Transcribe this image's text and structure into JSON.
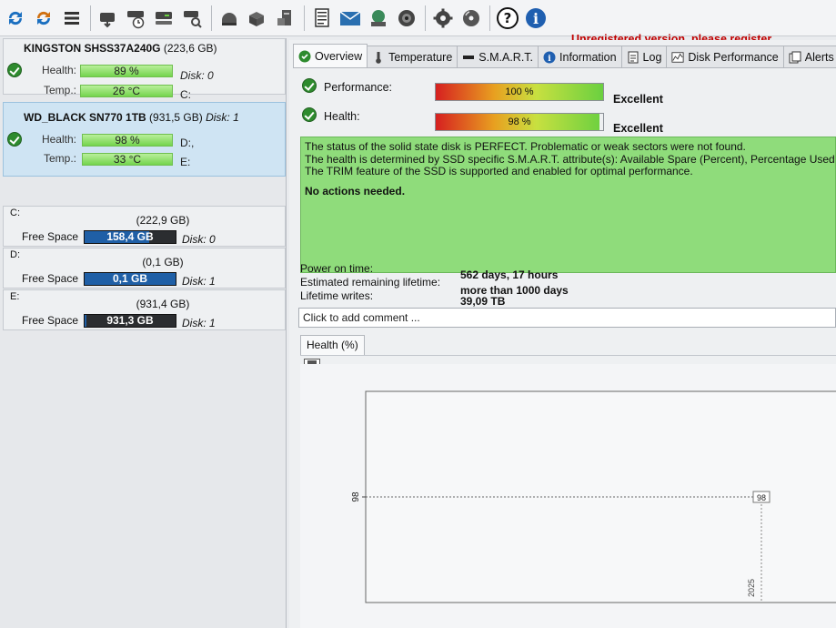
{
  "register_text": "Unregistered version, please register.",
  "disks": [
    {
      "model": "KINGSTON SHSS37A240G",
      "size": "(223,6 GB)",
      "disk_label": "",
      "health_label": "Health:",
      "health_value": "89 %",
      "temp_label": "Temp.:",
      "temp_value": "26 °C",
      "disk_index": "Disk: 0",
      "volume": "C:"
    },
    {
      "model": "WD_BLACK SN770 1TB",
      "size": "(931,5 GB)",
      "disk_label": "Disk: 1",
      "health_label": "Health:",
      "health_value": "98 %",
      "temp_label": "Temp.:",
      "temp_value": "33 °C",
      "disk_index": "D:,",
      "volume": "E:"
    }
  ],
  "volumes": [
    {
      "letter": "C:",
      "total": "(222,9 GB)",
      "free_label": "Free Space",
      "free": "158,4 GB",
      "free_fraction": 0.71,
      "disk": "Disk: 0"
    },
    {
      "letter": "D:",
      "total": "(0,1 GB)",
      "free_label": "Free Space",
      "free": "0,1 GB",
      "free_fraction": 1.0,
      "disk": "Disk: 1"
    },
    {
      "letter": "E:",
      "total": "(931,4 GB)",
      "free_label": "Free Space",
      "free": "931,3 GB",
      "free_fraction": 0.02,
      "disk": "Disk: 1"
    }
  ],
  "tabs": [
    "Overview",
    "Temperature",
    "S.M.A.R.T.",
    "Information",
    "Log",
    "Disk Performance",
    "Alerts"
  ],
  "overview": {
    "performance_label": "Performance:",
    "performance_value": "100 %",
    "performance_fraction": 1.0,
    "performance_word": "Excellent",
    "health_label": "Health:",
    "health_value": "98 %",
    "health_fraction": 0.98,
    "health_word": "Excellent",
    "status_lines": [
      "The status of the solid state disk is PERFECT. Problematic or weak sectors were not found.",
      "The health is determined by SSD specific S.M.A.R.T. attribute(s):  Available Spare (Percent), Percentage Used",
      "The TRIM feature of the SSD is supported and enabled for optimal performance."
    ],
    "actions": "No actions needed.",
    "power_on_label": "Power on time:",
    "power_on_value": "562 days, 17 hours",
    "remaining_label": "Estimated remaining lifetime:",
    "remaining_value": "more than 1000 days",
    "writes_label": "Lifetime writes:",
    "writes_value": "39,09 TB",
    "comment_placeholder": "Click to add comment ..."
  },
  "chart_data": {
    "type": "line",
    "tab_label": "Health (%)",
    "ytick_labels": [
      "98"
    ],
    "x_tick_labels": [
      "2025"
    ],
    "series": [
      {
        "values": [
          98,
          98
        ]
      }
    ],
    "point_label": "98",
    "ylim": [
      97,
      99
    ]
  }
}
